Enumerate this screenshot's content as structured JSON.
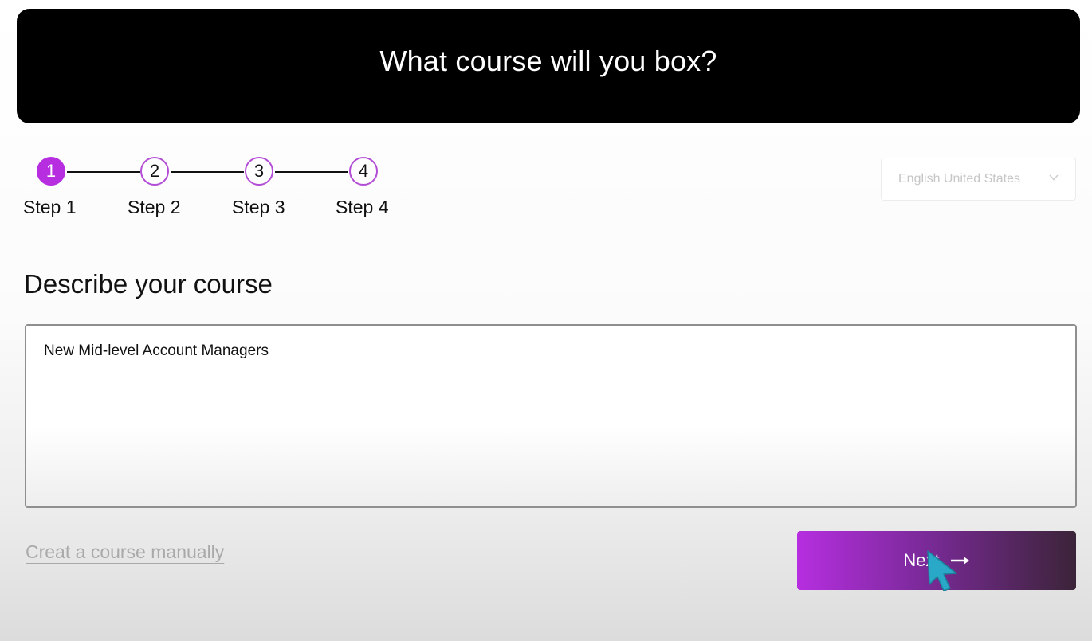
{
  "header": {
    "title": "What course will you box?"
  },
  "stepper": {
    "steps": [
      {
        "number": "1",
        "label": "Step 1",
        "active": true
      },
      {
        "number": "2",
        "label": "Step 2",
        "active": false
      },
      {
        "number": "3",
        "label": "Step 3",
        "active": false
      },
      {
        "number": "4",
        "label": "Step 4",
        "active": false
      }
    ]
  },
  "language": {
    "selected": "English United States",
    "icon": "chevron-down-icon"
  },
  "form": {
    "section_title": "Describe your course",
    "description_value": "New Mid-level Account Managers"
  },
  "footer": {
    "manual_link": "Creat a course manually",
    "next_label": "Next",
    "next_icon": "arrow-right-icon"
  },
  "colors": {
    "accent": "#b62ee0",
    "header_bg": "#000000",
    "cursor": "#2aa8c8"
  }
}
